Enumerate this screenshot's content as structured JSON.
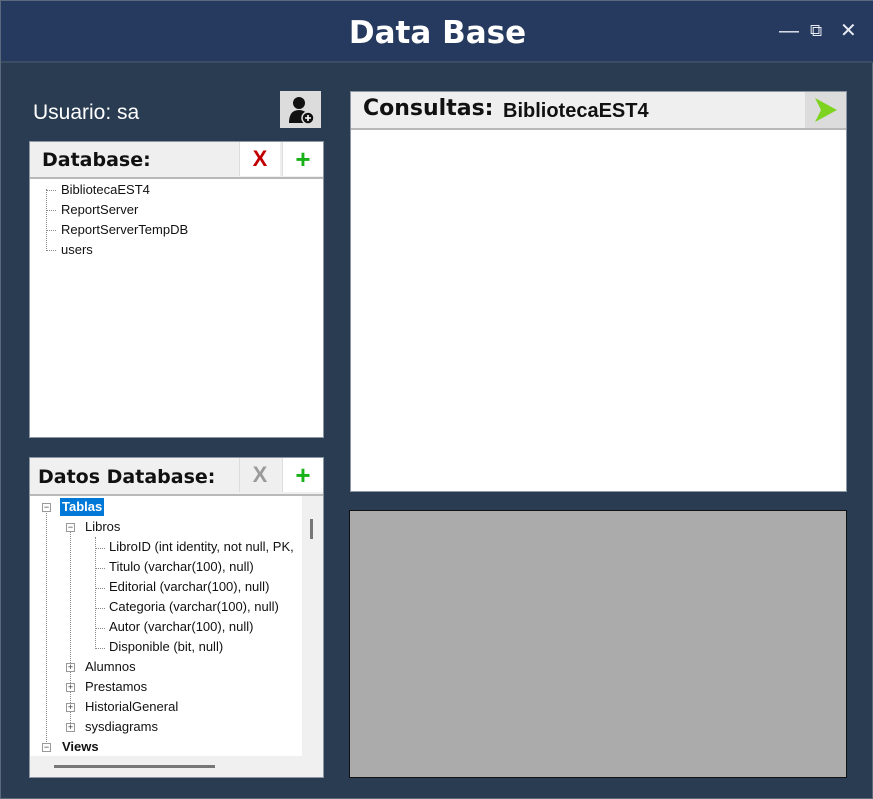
{
  "window": {
    "title": "Data Base",
    "controls": {
      "minimize": "—",
      "restore": "⧉",
      "close": "✕"
    }
  },
  "user": {
    "label": "Usuario: sa",
    "add_user_icon": "user-add-icon"
  },
  "database_panel": {
    "title": "Database:",
    "delete_label": "X",
    "add_label": "+",
    "delete_color": "#c00000",
    "add_color": "#17b217",
    "items": [
      "BibliotecaEST4",
      "ReportServer",
      "ReportServerTempDB",
      "users"
    ]
  },
  "datos_panel": {
    "title": "Datos Database:",
    "delete_label": "X",
    "add_label": "+",
    "tree": {
      "tablas": "Tablas",
      "libros": "Libros",
      "columns": [
        "LibroID (int identity, not null, PK,",
        "Titulo (varchar(100), null)",
        "Editorial (varchar(100), null)",
        "Categoria (varchar(100), null)",
        "Autor (varchar(100), null)",
        "Disponible (bit, null)"
      ],
      "tables": [
        "Alumnos",
        "Prestamos",
        "HistorialGeneral",
        "sysdiagrams"
      ],
      "views": "Views"
    }
  },
  "consultas": {
    "title": "Consultas:",
    "database": "BibliotecaEST4",
    "run_icon": "play-arrow-icon",
    "run_color": "#7ed321",
    "query_text": ""
  }
}
